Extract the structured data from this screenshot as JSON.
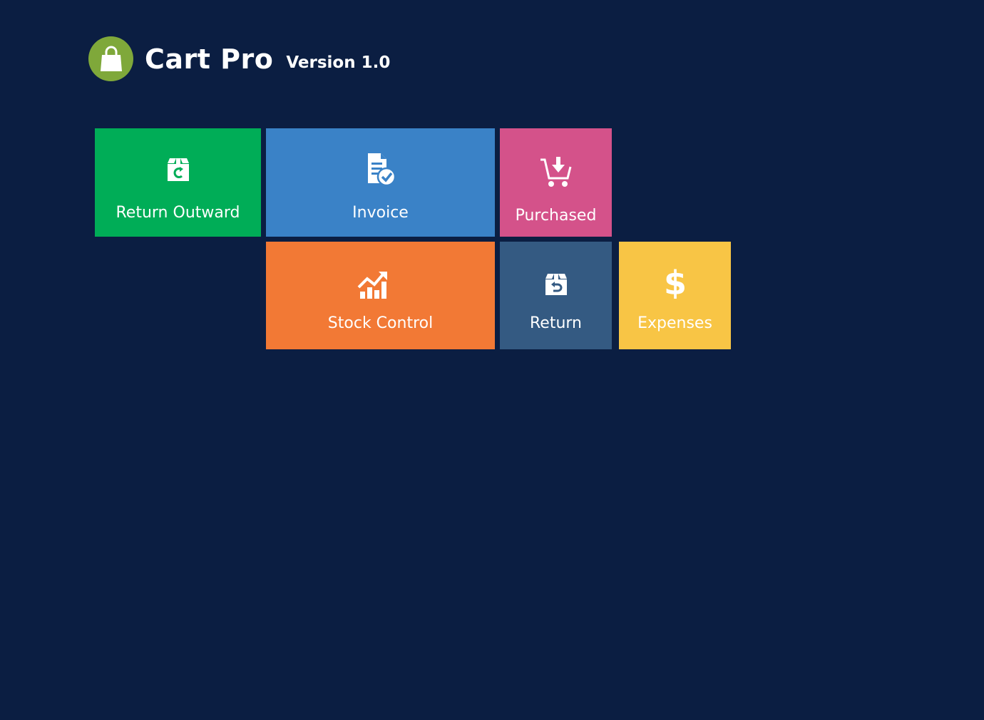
{
  "header": {
    "app_name": "Cart Pro",
    "version": "Version 1.0",
    "logo_icon": "shopping-bag-icon"
  },
  "colors": {
    "background": "#0b1e42",
    "logo": "#7fa83a",
    "return_outward": "#00ad57",
    "invoice": "#3a82c7",
    "purchased": "#d4528a",
    "stock_control": "#f27935",
    "return": "#345a82",
    "expenses": "#f8c545"
  },
  "tiles": {
    "return_outward": {
      "label": "Return Outward",
      "icon": "box-refresh-icon"
    },
    "invoice": {
      "label": "Invoice",
      "icon": "document-check-icon"
    },
    "purchased": {
      "label": "Purchased",
      "icon": "cart-download-icon"
    },
    "stock_control": {
      "label": "Stock Control",
      "icon": "chart-up-icon"
    },
    "return": {
      "label": "Return",
      "icon": "box-return-icon"
    },
    "expenses": {
      "label": "Expenses",
      "icon": "dollar-icon"
    }
  }
}
